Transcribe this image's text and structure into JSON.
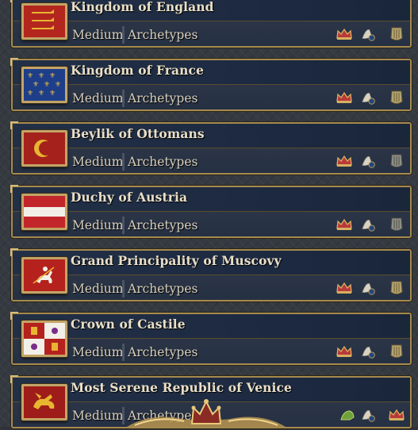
{
  "countries": [
    {
      "name": "Kingdom of England",
      "difficulty": "Medium",
      "archetypes": "Archetypes",
      "flag": "england-lions-flag"
    },
    {
      "name": "Kingdom of France",
      "difficulty": "Medium",
      "archetypes": "Archetypes",
      "flag": "france-fleur-de-lis-flag"
    },
    {
      "name": "Beylik of Ottomans",
      "difficulty": "Medium",
      "archetypes": "Archetypes",
      "flag": "ottoman-crescent-flag"
    },
    {
      "name": "Duchy of Austria",
      "difficulty": "Medium",
      "archetypes": "Archetypes",
      "flag": "austria-stripes-flag"
    },
    {
      "name": "Grand Principality of Muscovy",
      "difficulty": "Medium",
      "archetypes": "Archetypes",
      "flag": "muscovy-rider-flag"
    },
    {
      "name": "Crown of Castile",
      "difficulty": "Medium",
      "archetypes": "Archetypes",
      "flag": "castile-leon-flag"
    },
    {
      "name": "Most Serene Republic of Venice",
      "difficulty": "Medium",
      "archetypes": "Archetypes",
      "flag": "venice-lion-flag"
    }
  ],
  "archetype_icons": [
    "crown-icon",
    "scroll-icon",
    "shield-icon"
  ],
  "colors": {
    "frame_gold": "#a68a4f",
    "title_bar": "#223047",
    "detail_bar": "#2b3546",
    "text": "#e9dfc7"
  }
}
